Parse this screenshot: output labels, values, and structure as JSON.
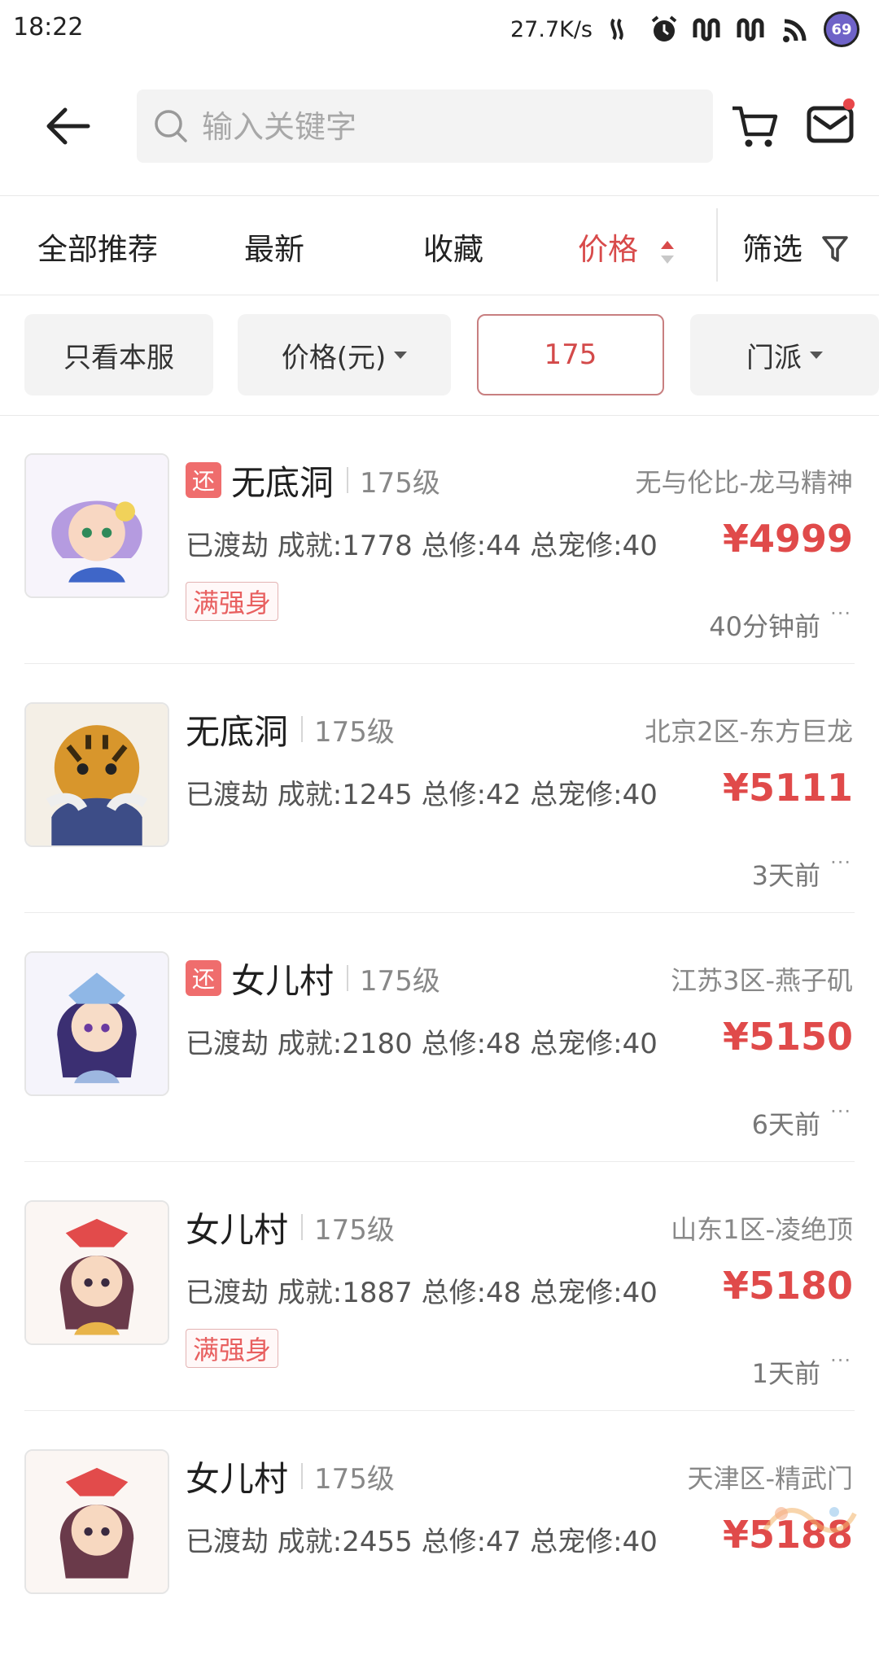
{
  "status_bar": {
    "time": "18:22",
    "net_speed": "27.7K/s",
    "battery": "69",
    "icons": [
      "nfc-icon",
      "alarm-icon",
      "signal-icon",
      "signal-icon",
      "wifi-icon",
      "battery-icon"
    ]
  },
  "header": {
    "search_placeholder": "输入关键字",
    "icons": [
      "back-arrow-icon",
      "search-icon",
      "cart-icon",
      "mail-icon"
    ],
    "accent_color": "#e04a4a"
  },
  "sort_tabs": [
    {
      "label": "全部推荐",
      "active": false
    },
    {
      "label": "最新",
      "active": false
    },
    {
      "label": "收藏",
      "active": false
    },
    {
      "label": "价格",
      "active": true
    },
    {
      "label": "筛选",
      "active": false
    }
  ],
  "filter_chips": [
    {
      "label": "只看本服"
    },
    {
      "label": "价格(元)"
    },
    {
      "label": "175"
    },
    {
      "label": "门派"
    }
  ],
  "listings": [
    {
      "returned": true,
      "return_label": "还",
      "sect": "无底洞",
      "level": "175级",
      "server": "无与伦比-龙马精神",
      "stats": "已渡劫 成就:1778 总修:44 总宠修:40",
      "price": "¥4999",
      "tag": "满强身",
      "time": "40分钟前",
      "more": "···"
    },
    {
      "returned": false,
      "return_label": "",
      "sect": "无底洞",
      "level": "175级",
      "server": "北京2区-东方巨龙",
      "stats": "已渡劫 成就:1245 总修:42 总宠修:40",
      "price": "¥5111",
      "tag": "",
      "time": "3天前",
      "more": "···"
    },
    {
      "returned": true,
      "return_label": "还",
      "sect": "女儿村",
      "level": "175级",
      "server": "江苏3区-燕子矶",
      "stats": "已渡劫 成就:2180 总修:48 总宠修:40",
      "price": "¥5150",
      "tag": "",
      "time": "6天前",
      "more": "···"
    },
    {
      "returned": false,
      "return_label": "",
      "sect": "女儿村",
      "level": "175级",
      "server": "山东1区-凌绝顶",
      "stats": "已渡劫 成就:1887 总修:48 总宠修:40",
      "price": "¥5180",
      "tag": "满强身",
      "time": "1天前",
      "more": "···"
    },
    {
      "returned": false,
      "return_label": "",
      "sect": "女儿村",
      "level": "175级",
      "server": "天津区-精武门",
      "stats": "已渡劫 成就:2455 总修:47 总宠修:40",
      "price": "¥5188",
      "tag": "",
      "time": "",
      "more": ""
    }
  ]
}
